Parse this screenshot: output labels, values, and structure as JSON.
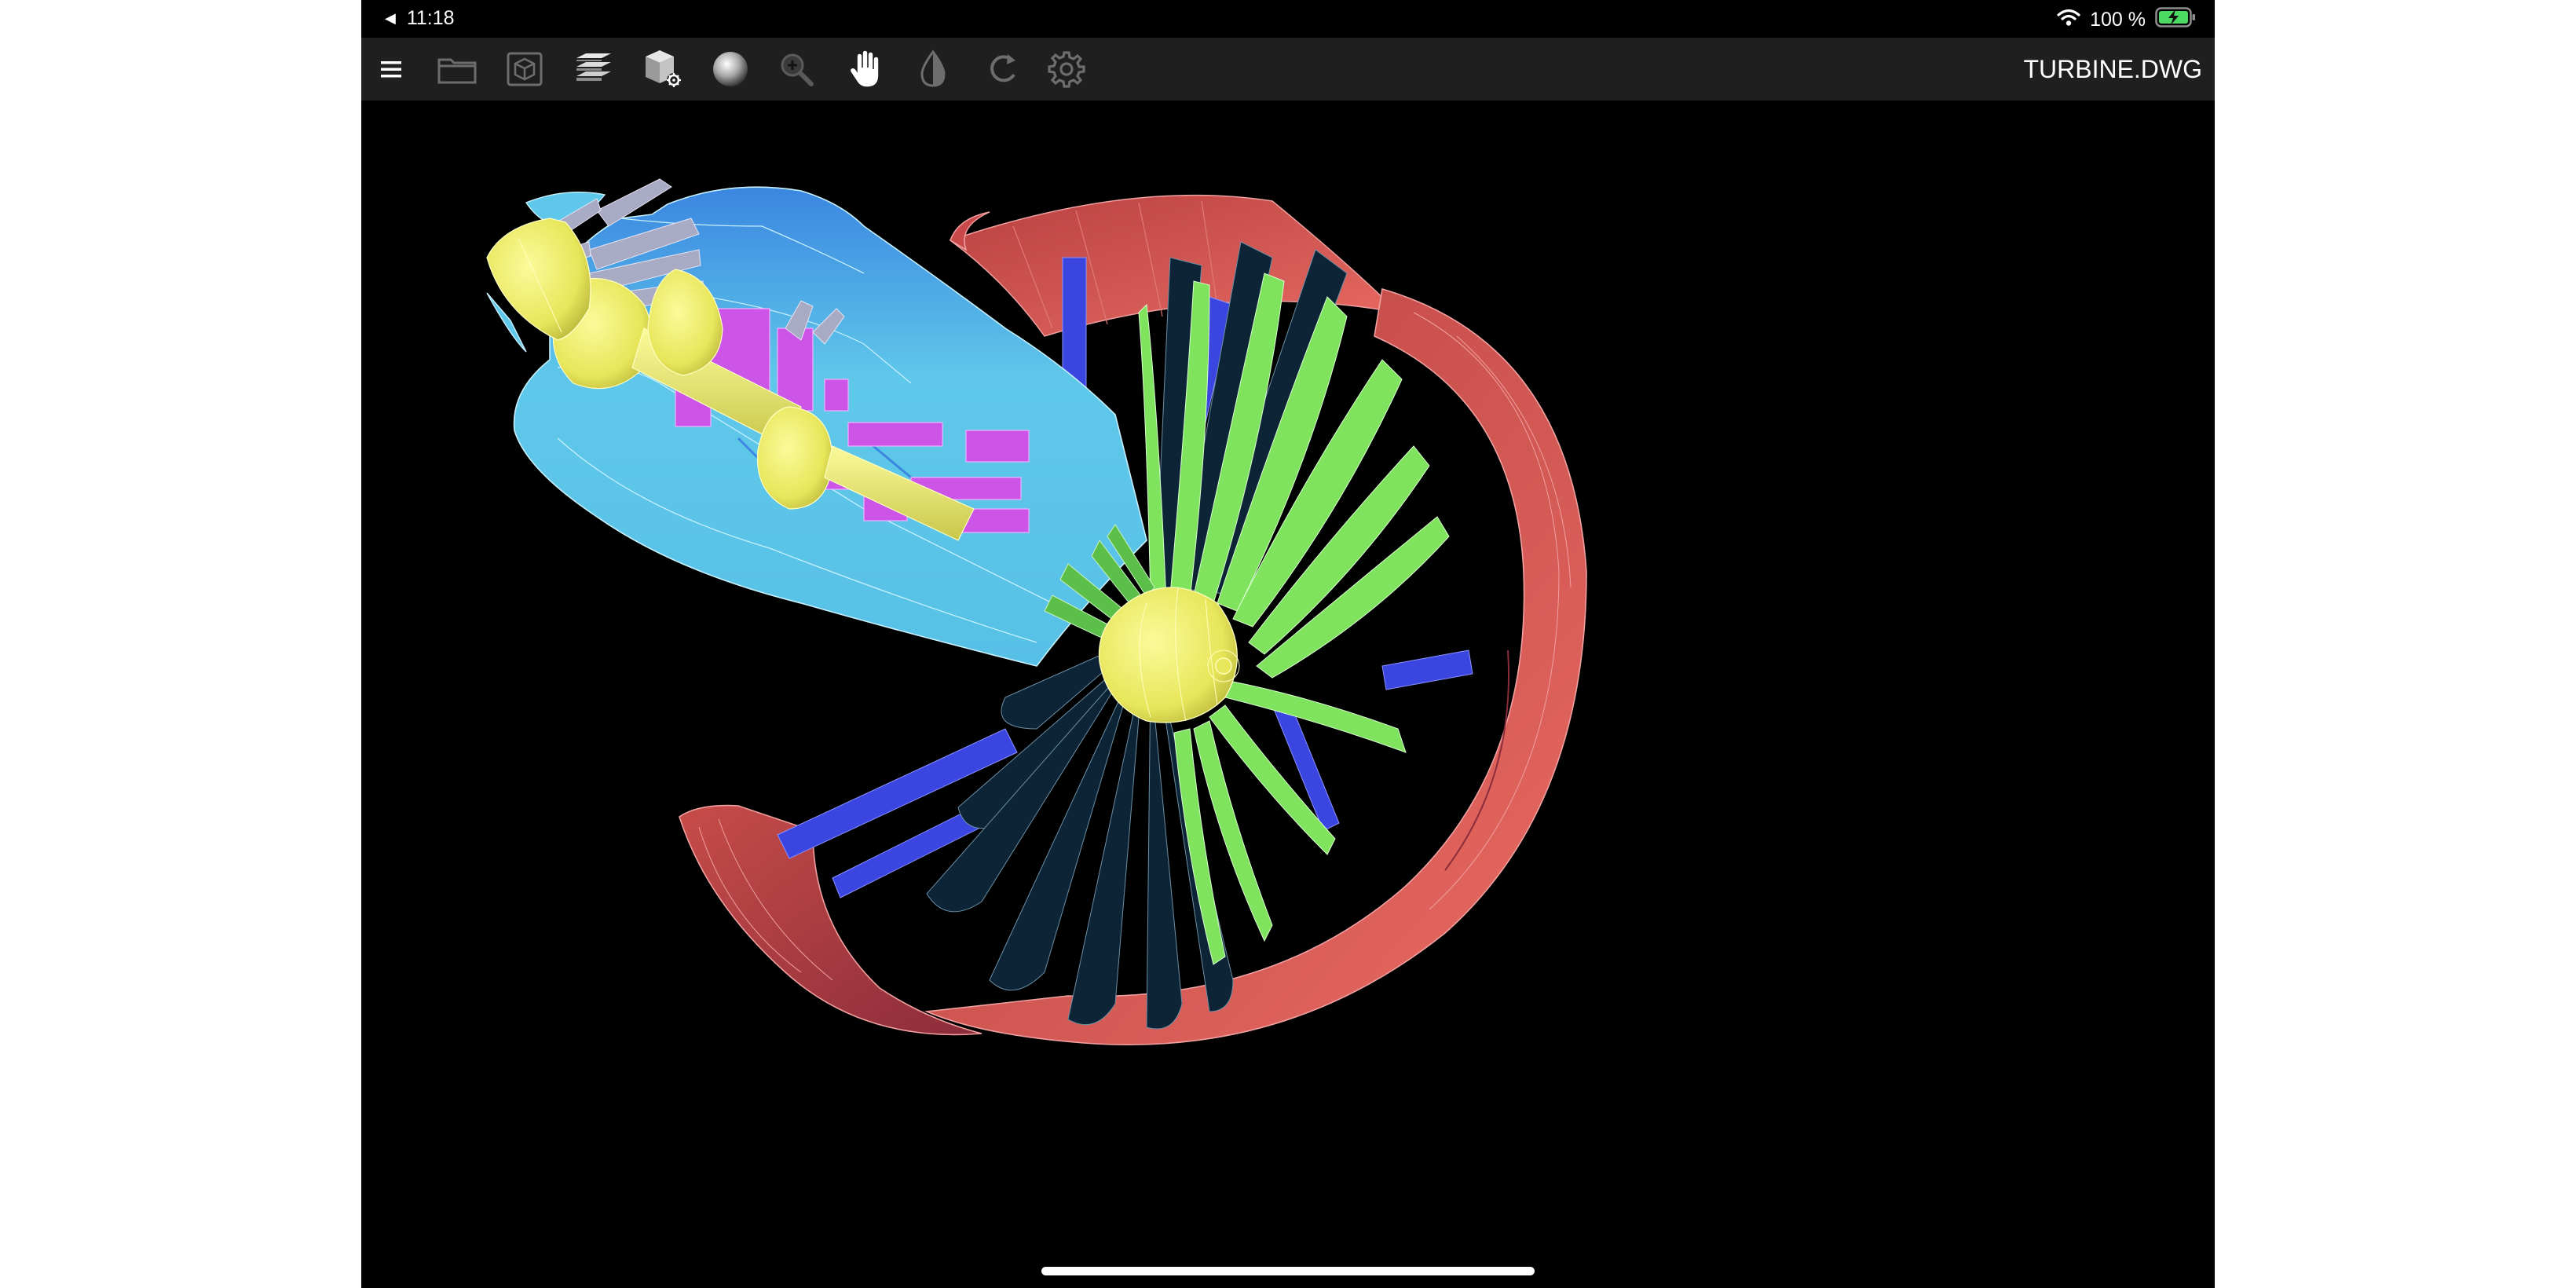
{
  "status_bar": {
    "back_indicator": "◀",
    "time": "11:18",
    "battery_text": "100 %",
    "icons": [
      "back-arrow-icon",
      "wifi-icon",
      "battery-charging-icon"
    ]
  },
  "toolbar": {
    "document_title": "TURBINE.DWG",
    "buttons": [
      {
        "name": "menu",
        "icon": "hamburger-menu-icon",
        "enabled": true
      },
      {
        "name": "open-file",
        "icon": "folder-icon",
        "enabled": false
      },
      {
        "name": "view-cube",
        "icon": "cube-icon",
        "enabled": false
      },
      {
        "name": "layers",
        "icon": "layers-icon",
        "enabled": true
      },
      {
        "name": "model-settings",
        "icon": "box-gear-icon",
        "enabled": true
      },
      {
        "name": "shading",
        "icon": "sphere-icon",
        "enabled": true
      },
      {
        "name": "zoom",
        "icon": "magnifier-icon",
        "enabled": true
      },
      {
        "name": "pan",
        "icon": "hand-icon",
        "enabled": true,
        "active": true
      },
      {
        "name": "contrast",
        "icon": "contrast-drop-icon",
        "enabled": false
      },
      {
        "name": "rotate",
        "icon": "rotate-icon",
        "enabled": false
      },
      {
        "name": "settings",
        "icon": "gear-icon",
        "enabled": false
      }
    ]
  },
  "viewport": {
    "model": "jet turbine cutaway 3D model",
    "colors": {
      "background": "#000000",
      "nacelle": "#d9534e",
      "casing": "#5fc8ea",
      "spinner": "#f2f060",
      "fan_blades_lit": "#7fe35e",
      "fan_blades_dark": "#0e2a3a",
      "struts": "#3b46e0",
      "internals": "#cc55e8",
      "compressor_blades": "#a9aac4"
    }
  }
}
